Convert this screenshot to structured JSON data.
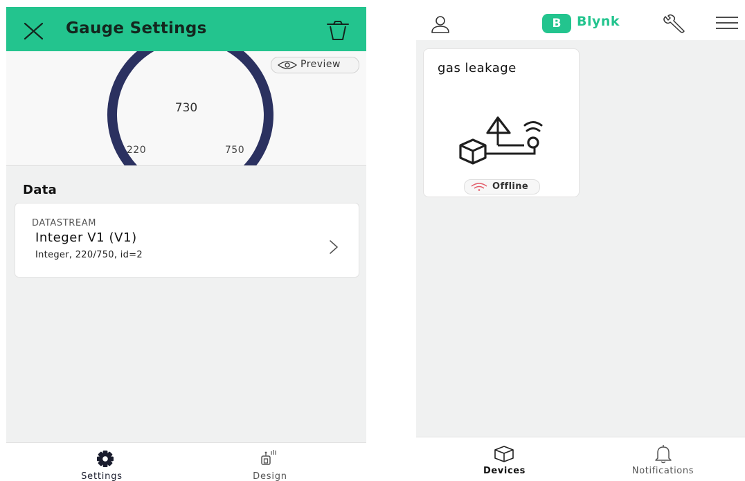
{
  "colors": {
    "brand_green": "#23c48e",
    "gauge_arc": "#2b3160",
    "offline_red": "#e35d6a",
    "background": "#f0f1f1"
  },
  "gauge_settings": {
    "header": {
      "title": "Gauge Settings",
      "close_icon": "close-x-icon",
      "delete_icon": "trash-icon"
    },
    "preview": {
      "label": "Preview",
      "icon": "eye-icon",
      "gauge": {
        "value": "730",
        "min": "220",
        "max": "750",
        "current": 730,
        "min_value": 220,
        "max_value": 750
      }
    },
    "data_section": {
      "heading": "Data",
      "datastream": {
        "caption": "DATASTREAM",
        "name": "Integer V1 (V1)",
        "details": "Integer, 220/750, id=2",
        "chevron_icon": "chevron-right-icon"
      }
    },
    "tabs": [
      {
        "label": "Settings",
        "icon": "gear-icon",
        "active": true
      },
      {
        "label": "Design",
        "icon": "design-icon",
        "active": false
      }
    ]
  },
  "devices_screen": {
    "header": {
      "logo_badge": "B",
      "logo_text": "Blynk",
      "profile_icon": "user-icon",
      "tools_icon": "wrench-icon",
      "menu_icon": "hamburger-menu-icon"
    },
    "device": {
      "name": "gas leakage",
      "status": "Offline",
      "status_icon": "wifi-off-icon",
      "illustration": "device-template-icon"
    },
    "tabs": [
      {
        "label": "Devices",
        "icon": "cube-icon",
        "active": true
      },
      {
        "label": "Notifications",
        "icon": "bell-icon",
        "active": false
      }
    ]
  }
}
